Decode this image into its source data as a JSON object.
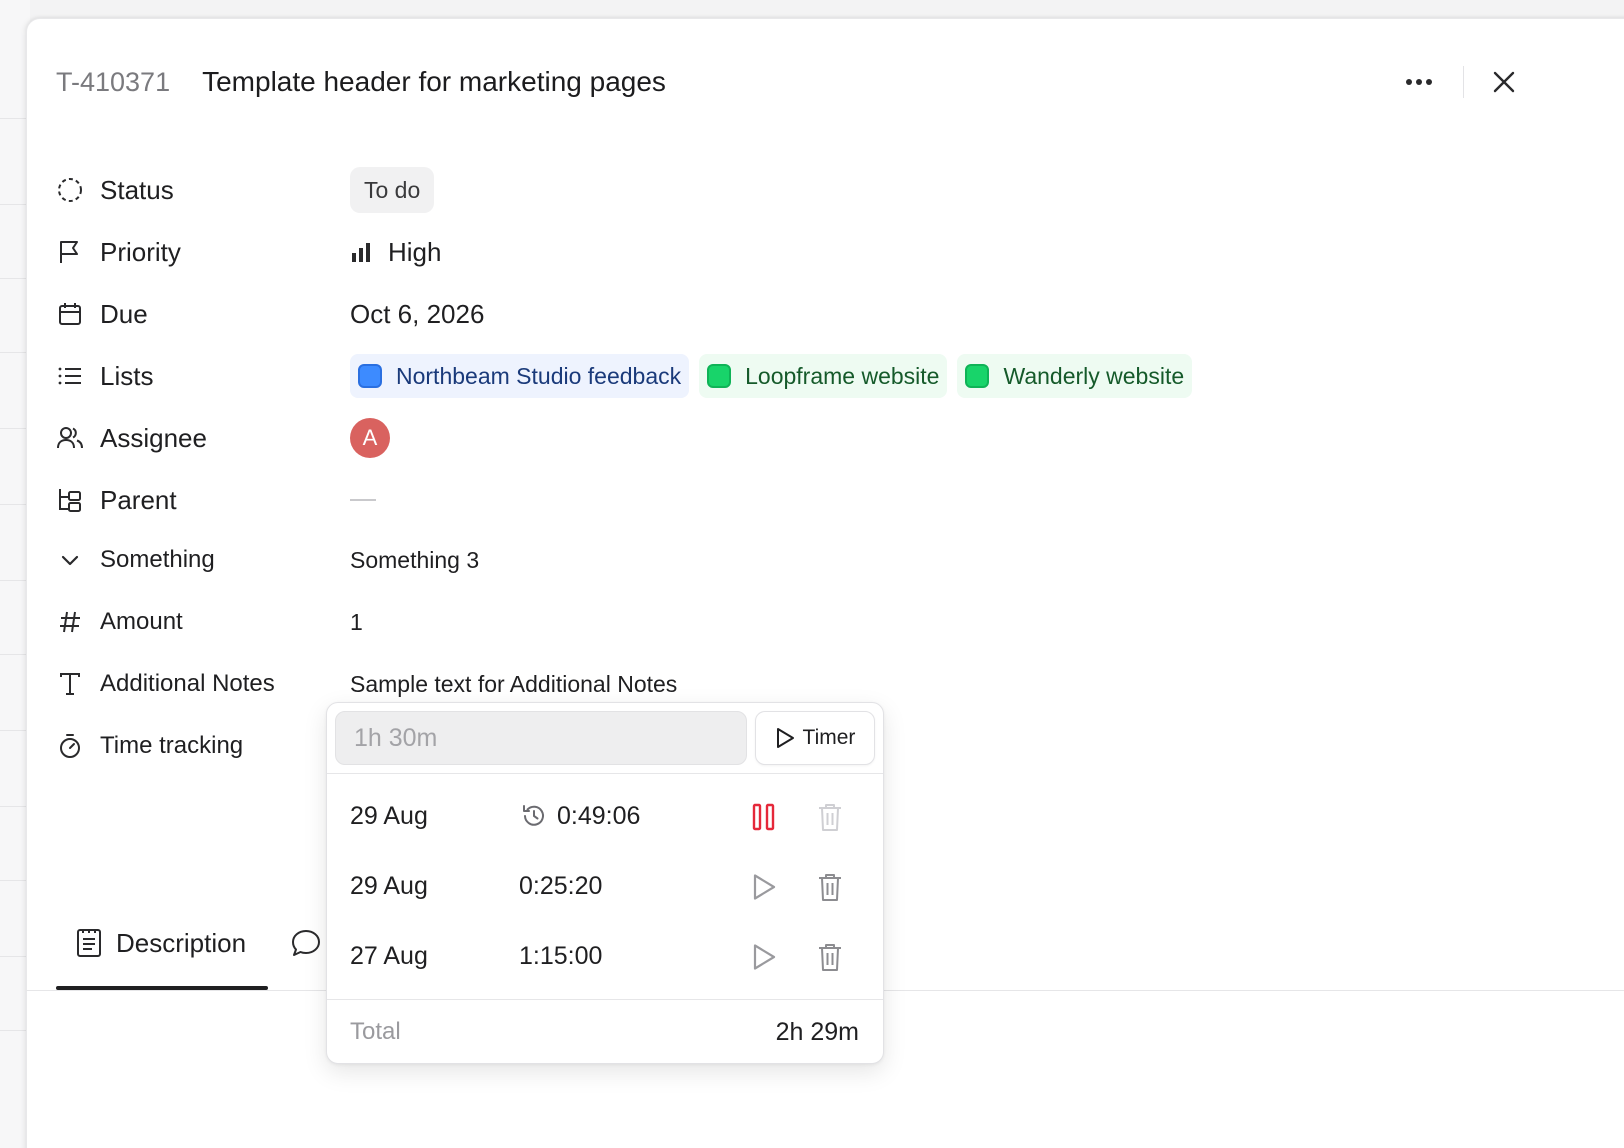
{
  "task": {
    "id": "T-410371",
    "title": "Template header for marketing pages"
  },
  "icons": {
    "more": "more-horizontal-icon",
    "close": "close-icon"
  },
  "properties": {
    "status": {
      "label": "Status",
      "value": "To do"
    },
    "priority": {
      "label": "Priority",
      "value": "High"
    },
    "due": {
      "label": "Due",
      "value": "Oct 6, 2026"
    },
    "lists": {
      "label": "Lists",
      "items": [
        {
          "name": "Northbeam Studio feedback",
          "color": "#3d8bff"
        },
        {
          "name": "Loopframe website",
          "color": "#18d46a"
        },
        {
          "name": "Wanderly website",
          "color": "#18d46a"
        }
      ]
    },
    "assignee": {
      "label": "Assignee",
      "initial": "A",
      "color": "#d9625f"
    },
    "parent": {
      "label": "Parent"
    },
    "something": {
      "label": "Something",
      "value": "Something 3"
    },
    "amount": {
      "label": "Amount",
      "value": "1"
    },
    "additional_notes": {
      "label": "Additional Notes",
      "value": "Sample text for Additional Notes"
    },
    "time_tracking": {
      "label": "Time tracking"
    }
  },
  "tabs": {
    "description": "Description"
  },
  "time_popover": {
    "input_placeholder": "1h 30m",
    "timer_label": "Timer",
    "entries": [
      {
        "date": "29 Aug",
        "duration": "0:49:06",
        "running": true
      },
      {
        "date": "29 Aug",
        "duration": "0:25:20",
        "running": false
      },
      {
        "date": "27 Aug",
        "duration": "1:15:00",
        "running": false
      }
    ],
    "total_label": "Total",
    "total_value": "2h 29m",
    "pause_color": "#e5283a"
  }
}
